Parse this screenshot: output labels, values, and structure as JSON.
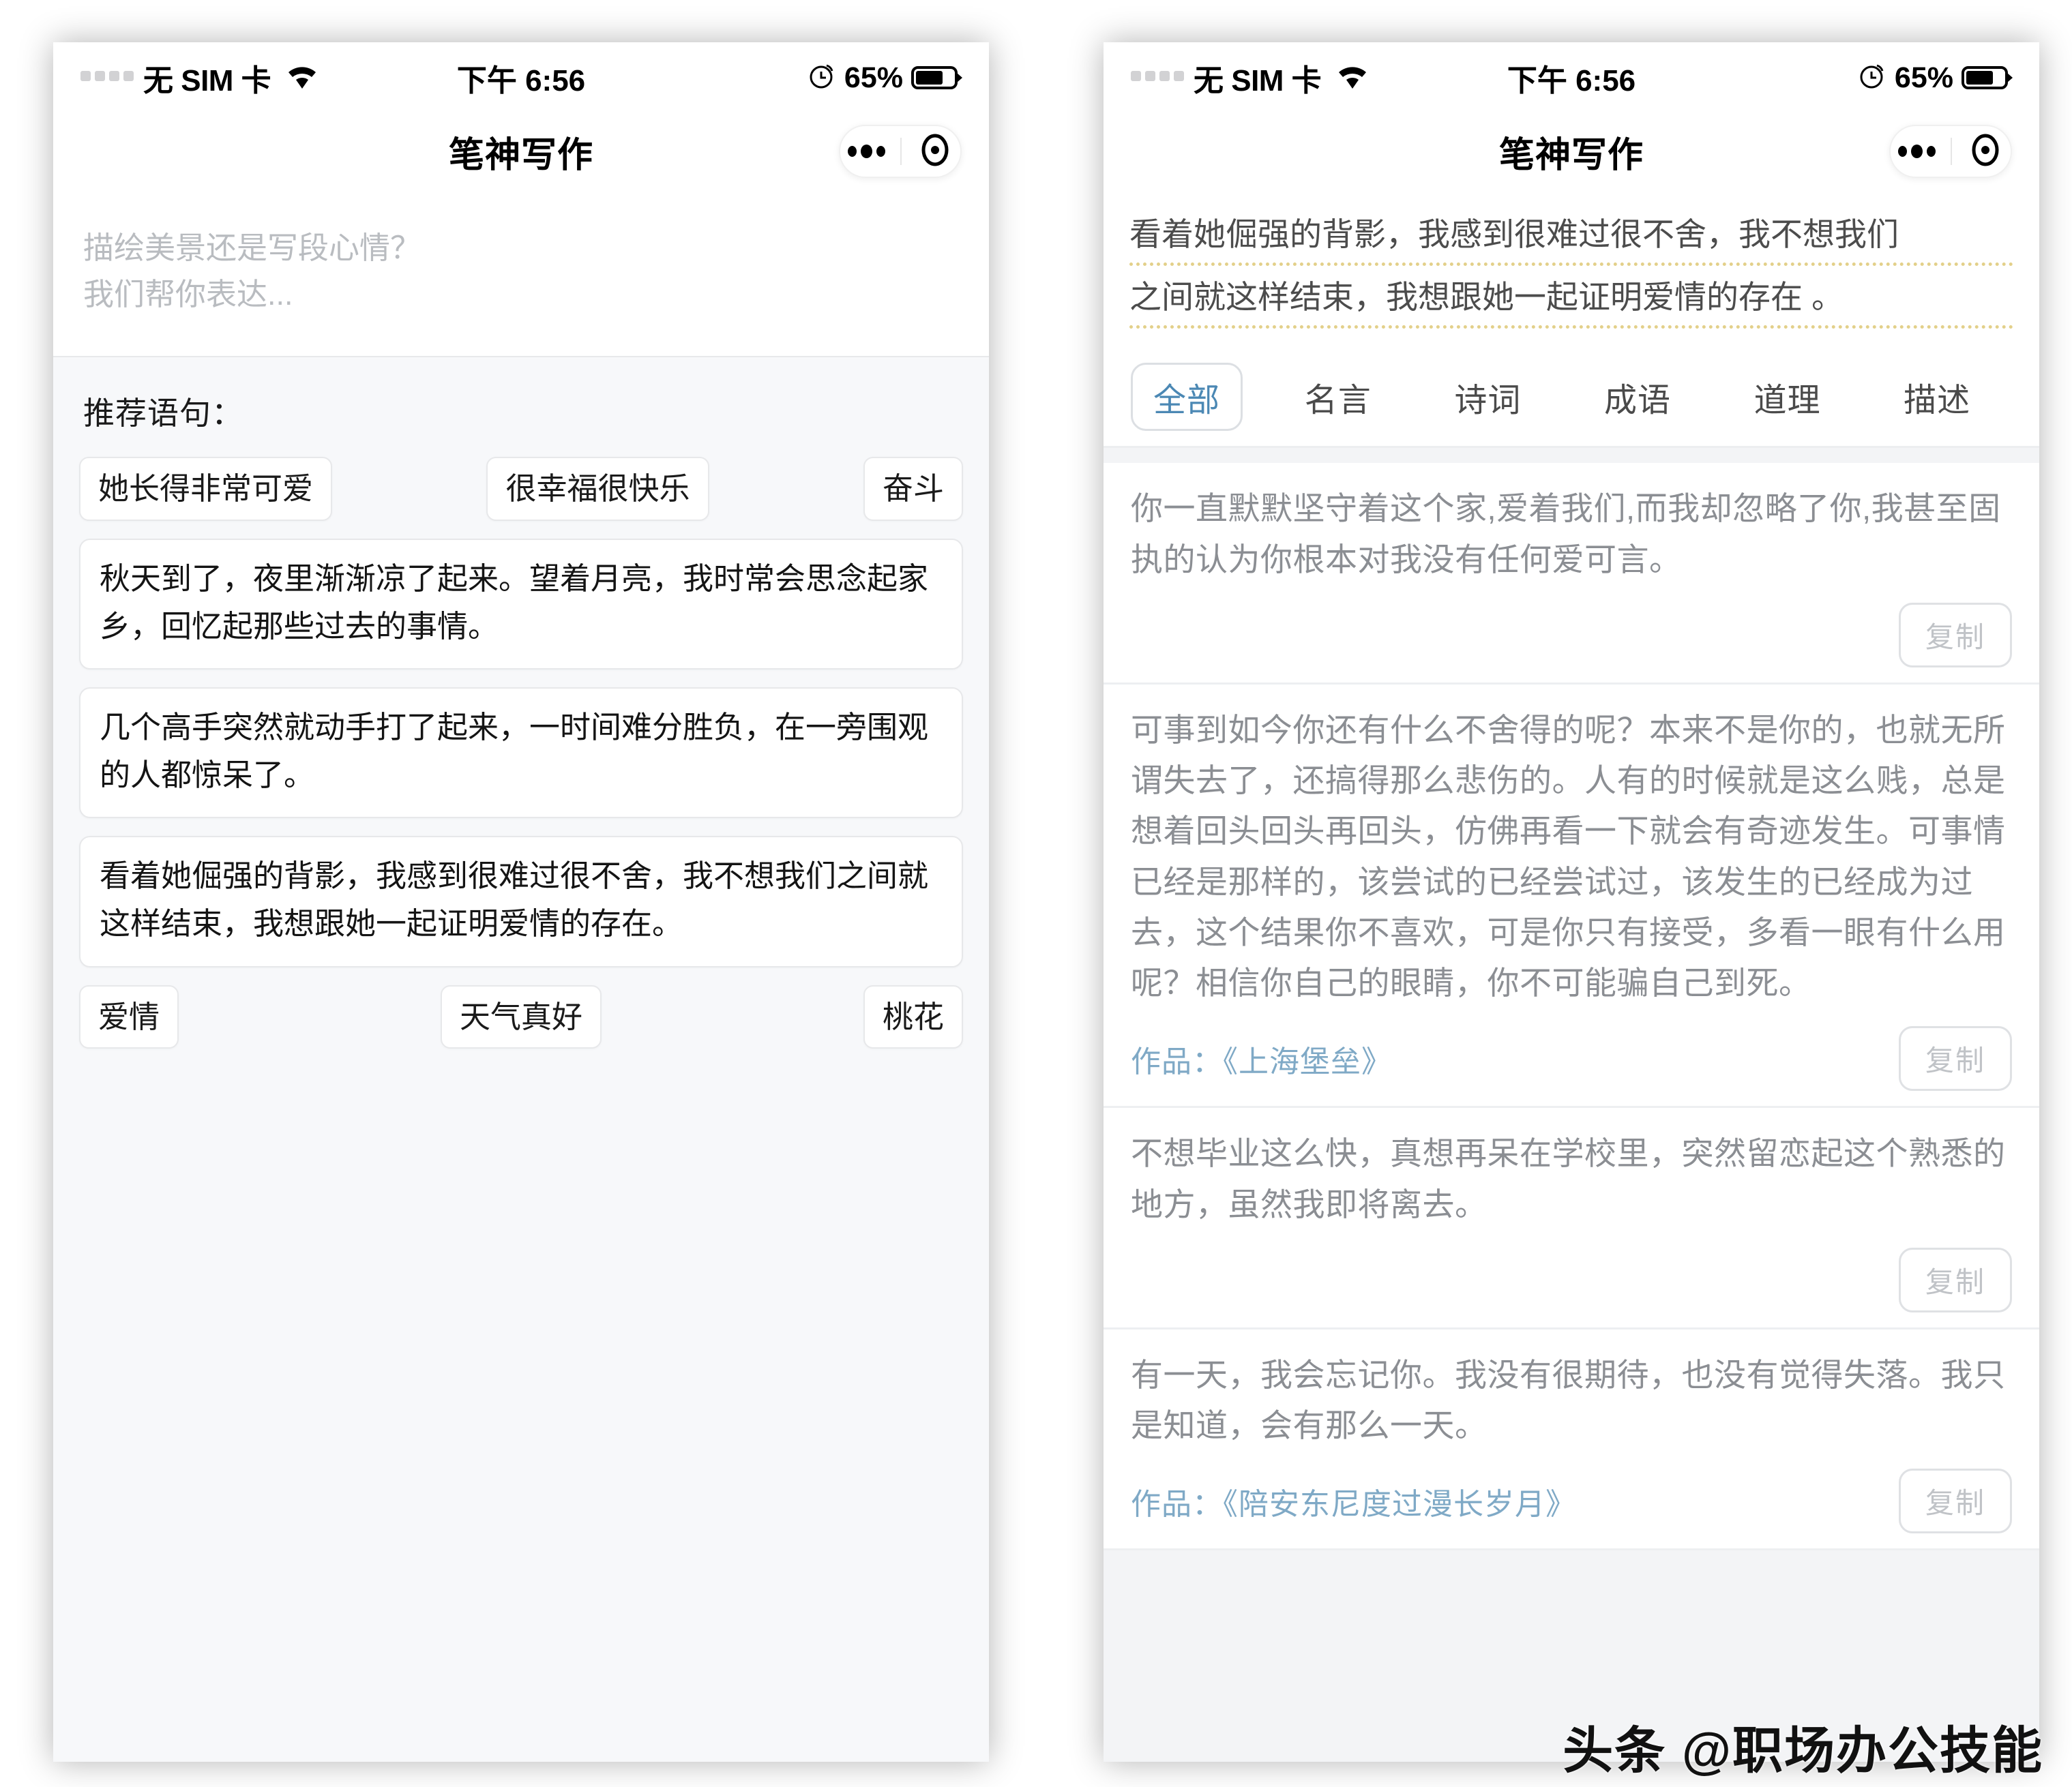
{
  "status_bar": {
    "carrier": "无 SIM 卡",
    "time": "下午 6:56",
    "battery_percent": "65%",
    "signal_icon": "signal-dots-icon",
    "wifi_icon": "wifi-icon",
    "alarm_icon": "alarm-icon",
    "battery_icon": "battery-icon"
  },
  "navbar": {
    "title": "笔神写作",
    "more_icon": "more-dots-icon",
    "target_icon": "capsule-close-icon"
  },
  "left_panel": {
    "compose": {
      "placeholder_line1": "描绘美景还是写段心情？",
      "placeholder_line2": "我们帮你表达...",
      "value": ""
    },
    "suggestions": {
      "title": "推荐语句：",
      "chips_top": [
        "她长得非常可爱",
        "很幸福很快乐",
        "奋斗"
      ],
      "sentences": [
        "秋天到了，夜里渐渐凉了起来。望着月亮，我时常会思念起家乡，回忆起那些过去的事情。",
        "几个高手突然就动手打了起来，一时间难分胜负，在一旁围观的人都惊呆了。",
        "看着她倔强的背影，我感到很难过很不舍，我不想我们之间就这样结束，我想跟她一起证明爱情的存在。"
      ],
      "chips_bottom": [
        "爱情",
        "天气真好",
        "桃花"
      ]
    }
  },
  "right_panel": {
    "query": {
      "line1": "看着她倔强的背影，我感到很难过很不舍，我不想我们",
      "line2": "之间就这样结束，我想跟她一起证明爱情的存在 。"
    },
    "tabs": [
      {
        "label": "全部",
        "active": true
      },
      {
        "label": "名言",
        "active": false
      },
      {
        "label": "诗词",
        "active": false
      },
      {
        "label": "成语",
        "active": false
      },
      {
        "label": "道理",
        "active": false
      },
      {
        "label": "描述",
        "active": false
      }
    ],
    "copy_label": "复制",
    "results": [
      {
        "text": "你一直默默坚守着这个家,爱着我们,而我却忽略了你,我甚至固执的认为你根本对我没有任何爱可言。",
        "source": ""
      },
      {
        "text": "可事到如今你还有什么不舍得的呢？本来不是你的，也就无所谓失去了，还搞得那么悲伤的。人有的时候就是这么贱，总是想着回头回头再回头，仿佛再看一下就会有奇迹发生。可事情已经是那样的，该尝试的已经尝试过，该发生的已经成为过去，这个结果你不喜欢，可是你只有接受，多看一眼有什么用呢？相信你自己的眼睛，你不可能骗自己到死。",
        "source": "作品：《上海堡垒》"
      },
      {
        "text": "不想毕业这么快，真想再呆在学校里，突然留恋起这个熟悉的地方，虽然我即将离去。",
        "source": ""
      },
      {
        "text": "有一天，我会忘记你。我没有很期待，也没有觉得失落。我只是知道，会有那么一天。",
        "source": "作品：《陪安东尼度过漫长岁月》"
      }
    ]
  },
  "watermark": "头条 @职场办公技能",
  "colors": {
    "accent_blue": "#4b88b4",
    "source_blue": "#7fa9c6",
    "underline_yellow": "#e3d08a",
    "page_bg": "#f3f4f6",
    "panel_bg": "#f7f8fa"
  }
}
